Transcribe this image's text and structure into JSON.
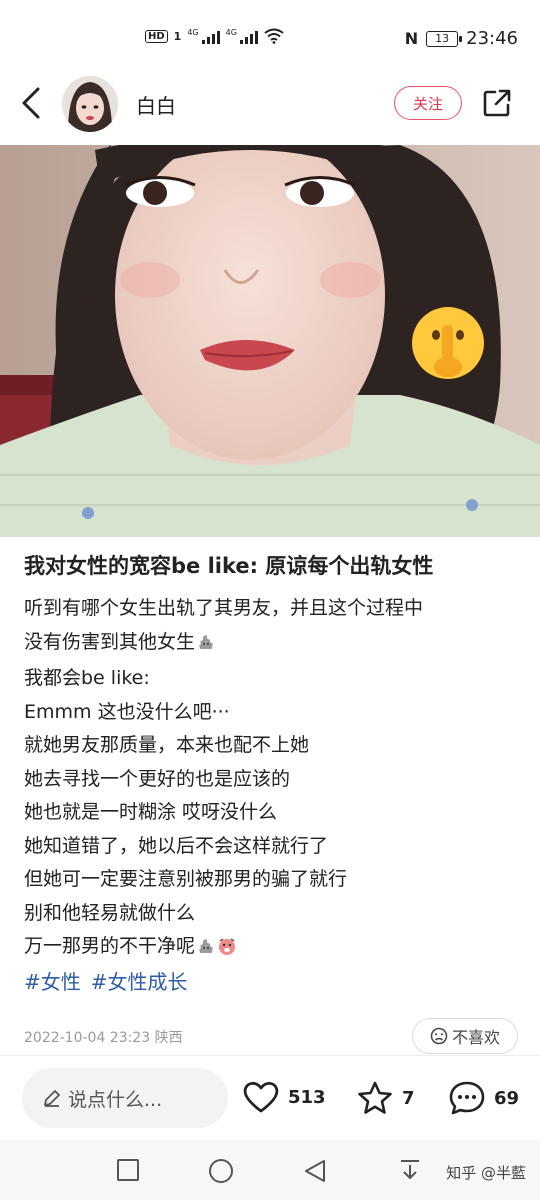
{
  "status_bar": {
    "hd_label": "HD",
    "sim1": "1",
    "net1": "4G",
    "net2": "4G",
    "battery": "13",
    "time": "23:46"
  },
  "header": {
    "username": "白白",
    "follow_label": "关注"
  },
  "post": {
    "title": "我对女性的宽容be like: 原谅每个出轨女性",
    "lines": [
      "听到有哪个女生出轨了其男友，并且这个过程中",
      "没有伤害到其他女生",
      "我都会be like:",
      "Emmm 这也没什么吧···",
      "就她男友那质量，本来也配不上她",
      "她去寻找一个更好的也是应该的",
      "她也就是一时糊涂 哎呀没什么",
      "她知道错了，她以后不会这样就行了",
      "但她可一定要注意别被那男的骗了就行",
      "别和他轻易就做什么",
      "万一那男的不干净呢"
    ],
    "tags": [
      "#女性",
      "#女性成长"
    ],
    "date": "2022-10-04 23:23",
    "location": "陕西",
    "dislike_label": "不喜欢"
  },
  "actions": {
    "comment_placeholder": "说点什么...",
    "likes": "513",
    "collects": "7",
    "comments": "69"
  },
  "watermark": "知乎 @半藍",
  "colors": {
    "accent": "#e0344f",
    "tag": "#2f5da8",
    "meta": "#9a9a9a"
  }
}
